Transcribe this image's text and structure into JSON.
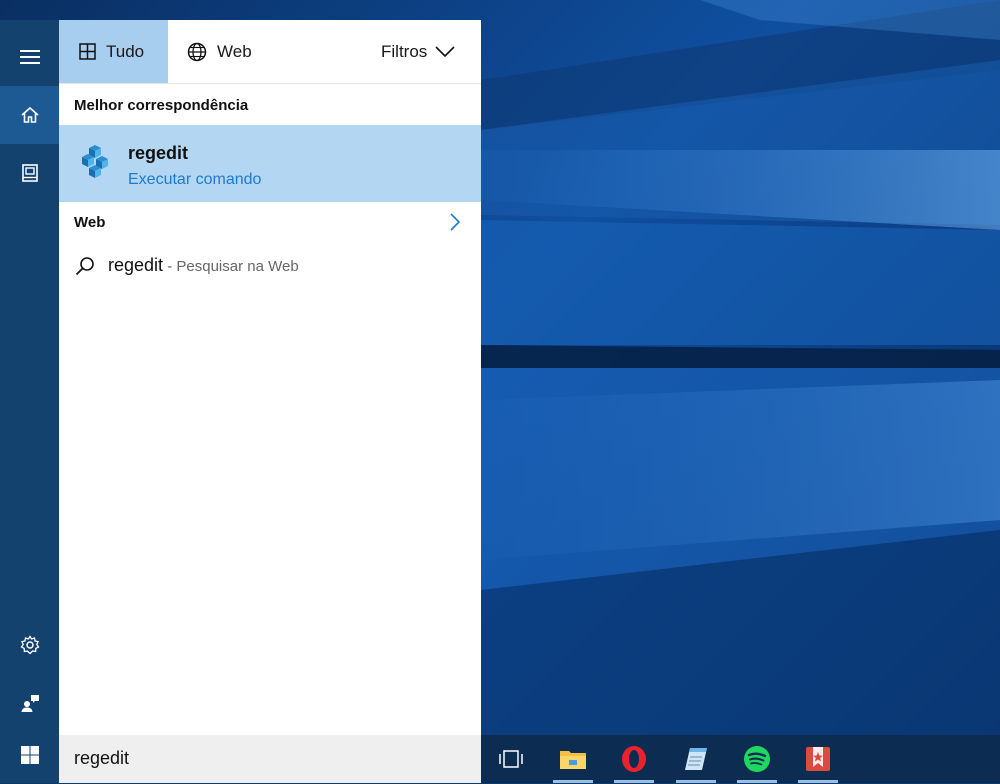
{
  "tabs": [
    {
      "label": "Tudo",
      "icon": "grid-icon",
      "active": true
    },
    {
      "label": "Web",
      "icon": "globe-icon",
      "active": false
    }
  ],
  "filters_label": "Filtros",
  "best_match": {
    "heading": "Melhor correspondência",
    "title": "regedit",
    "subtitle": "Executar comando",
    "icon": "registry-editor-icon"
  },
  "web_section": {
    "heading": "Web",
    "result_query": "regedit",
    "result_hint": " - Pesquisar na Web"
  },
  "search": {
    "value": "regedit"
  },
  "rail": {
    "items": [
      "hamburger-menu-icon",
      "home-icon",
      "notebook-icon",
      "settings-icon",
      "feedback-icon",
      "windows-start-icon"
    ]
  },
  "taskbar": {
    "items": [
      "task-view-icon",
      "file-explorer-icon",
      "opera-icon",
      "notepad-icon",
      "spotify-icon",
      "wunderlist-icon"
    ]
  },
  "colors": {
    "rail": "#14426f",
    "rail_active": "#1d5a94",
    "selected_tab": "#a7cdef",
    "best_match_bg": "#b3d6f2",
    "link_blue": "#1d7ad1",
    "taskbar": "#0d2c52"
  }
}
